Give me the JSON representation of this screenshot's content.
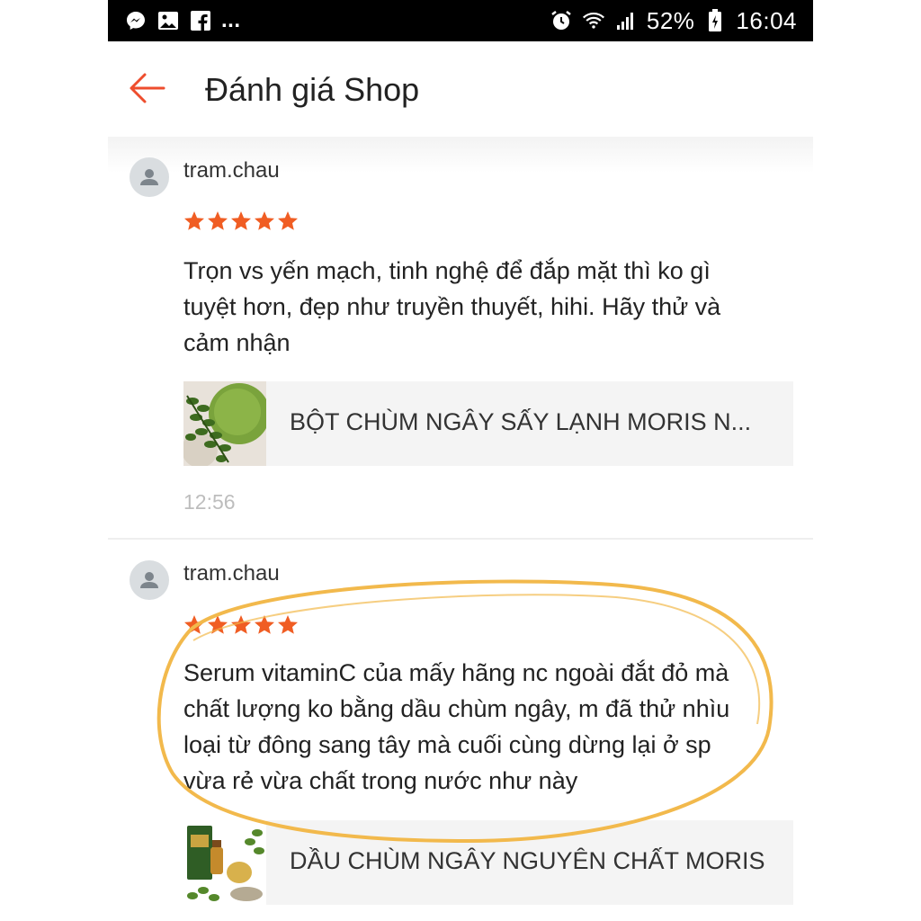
{
  "status_bar": {
    "battery": "52%",
    "time": "16:04",
    "more": "...",
    "icons": [
      "messenger-icon",
      "gallery-icon",
      "facebook-icon",
      "alarm-icon",
      "wifi-icon",
      "signal-icon",
      "battery-icon"
    ]
  },
  "header": {
    "title": "Đánh giá Shop",
    "back_icon": "arrow-left-icon",
    "accent_color": "#ee4d2d"
  },
  "reviews": [
    {
      "user": "tram.chau",
      "rating": 5,
      "text": [
        "Trọn vs yến mạch, tinh nghệ để đắp mặt thì ko gì",
        "tuyệt hơn, đẹp như truyền thuyết, hihi. Hãy thử và",
        "cảm nhận"
      ],
      "product": "BỘT CHÙM NGÂY SẤY LẠNH MORIS N...",
      "time": "12:56"
    },
    {
      "user": "tram.chau",
      "rating": 5,
      "text": [
        "Serum vitaminC của mấy hãng nc ngoài đắt đỏ mà",
        "chất lượng ko bằng dầu chùm ngây, m đã thử nhìu",
        "loại từ đông sang tây mà cuối cùng dừng lại ở sp",
        "vừa rẻ vừa chất trong nước như này"
      ],
      "product": "DẦU CHÙM NGÂY NGUYÊN CHẤT MORIS"
    }
  ],
  "colors": {
    "star": "#f05d23",
    "annotation": "#f2b94c",
    "product_bg": "#f4f4f4"
  }
}
